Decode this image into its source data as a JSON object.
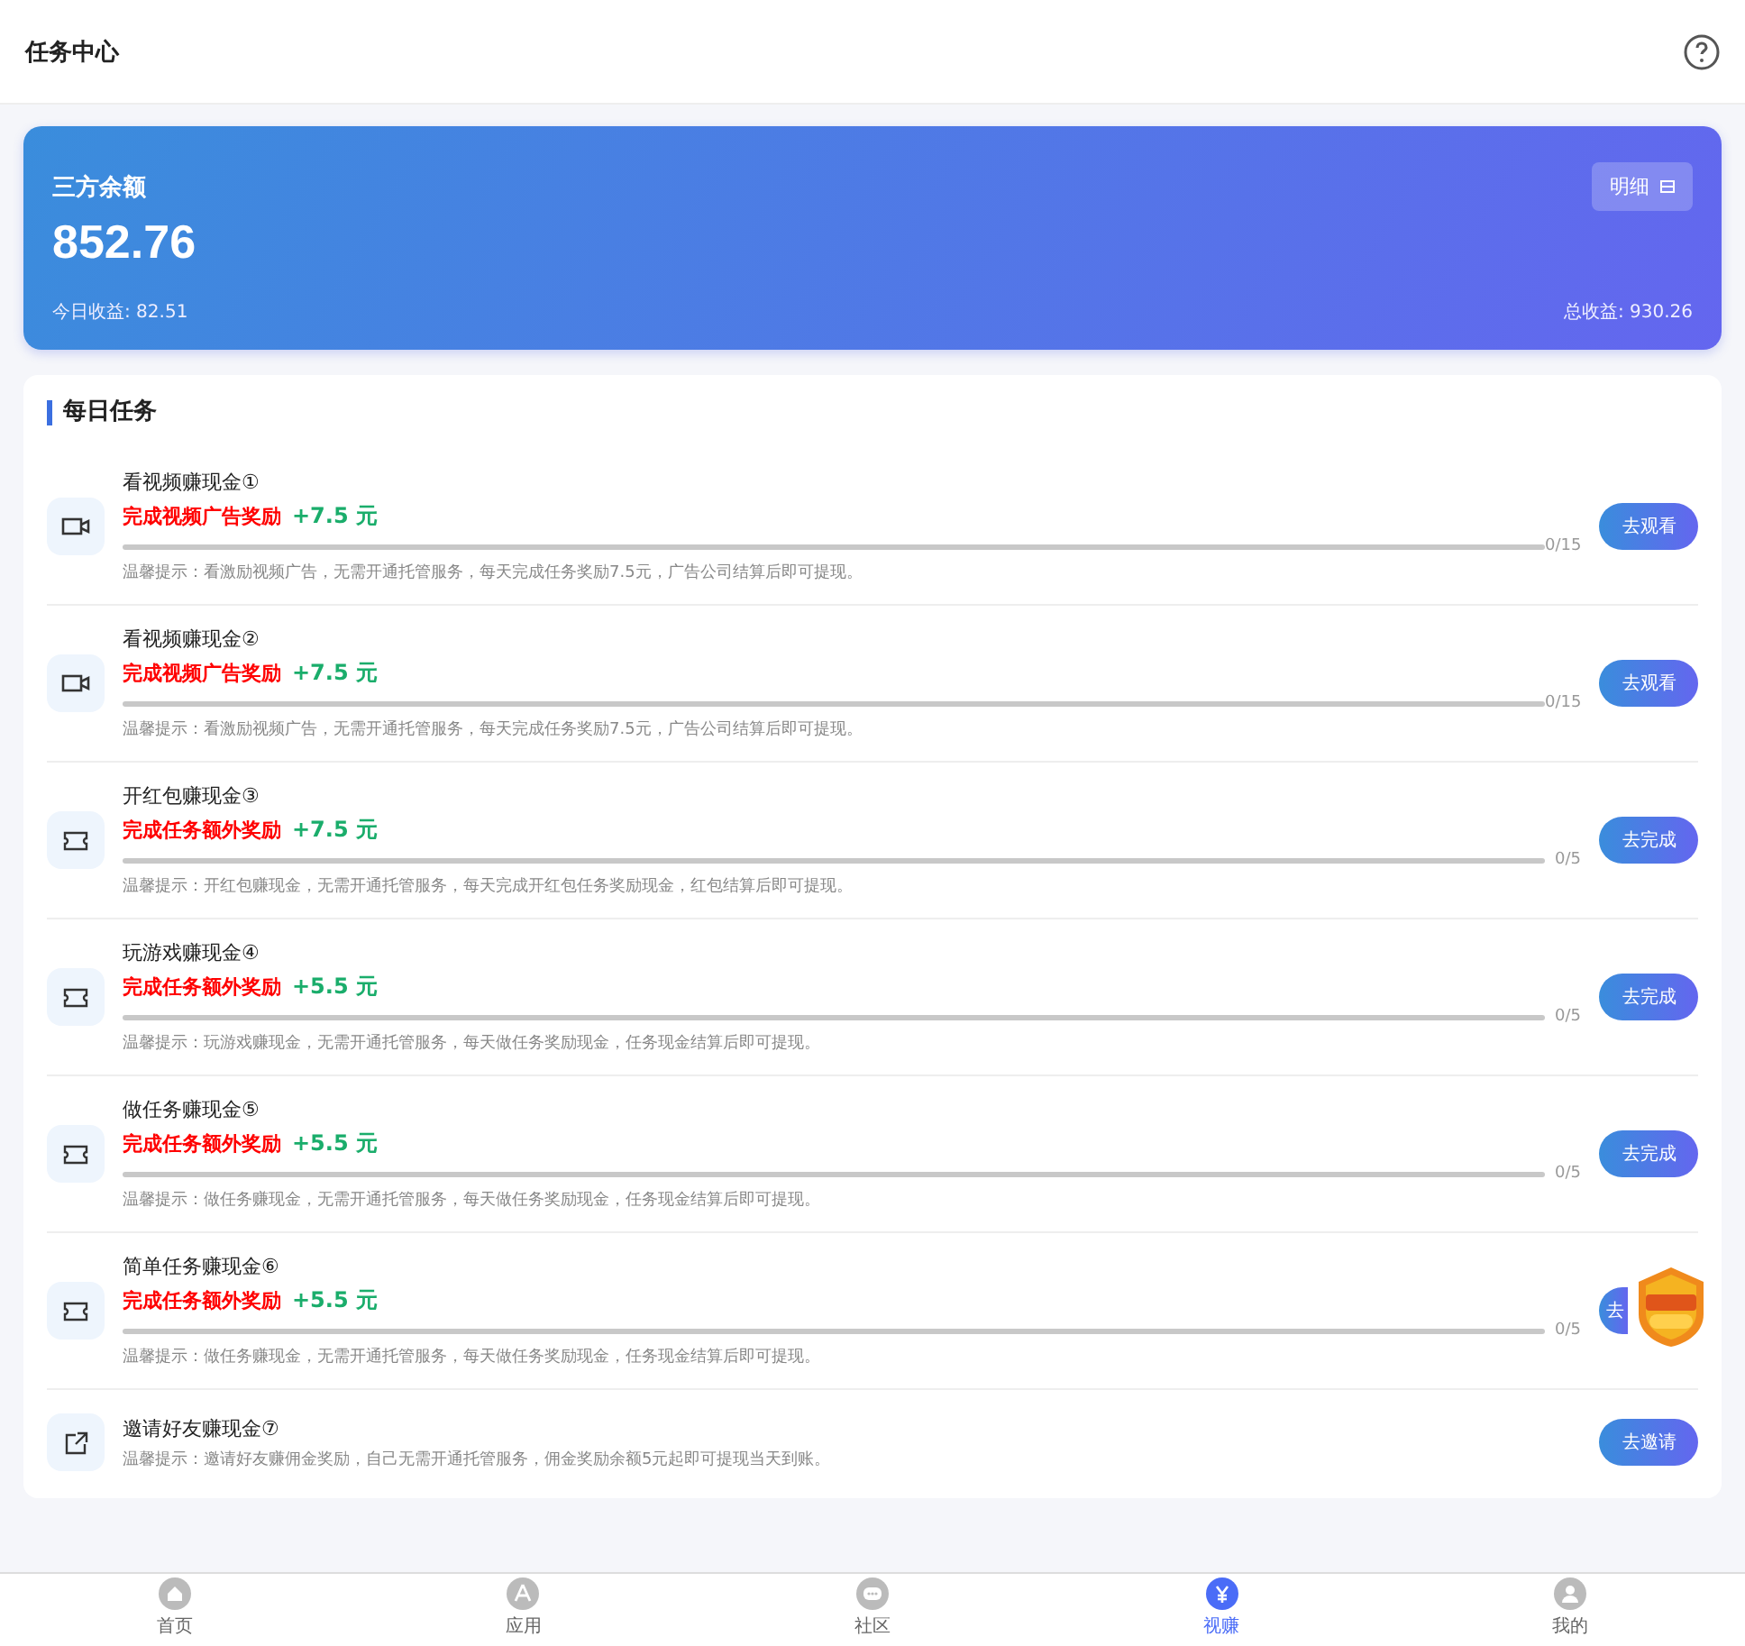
{
  "header": {
    "title": "任务中心"
  },
  "balance": {
    "label": "三方余额",
    "amount": "852.76",
    "detail_button": "明细",
    "today": "今日收益: 82.51",
    "total": "总收益: 930.26"
  },
  "daily": {
    "title": "每日任务",
    "tasks": [
      {
        "kind": "video",
        "name": "看视频赚现金①",
        "reward_label": "完成视频广告奖励",
        "reward": "+7.5 元",
        "level": 0,
        "progress": "0/15",
        "tip": "温馨提示：看激励视频广告，无需开通托管服务，每天完成任务奖励7.5元，广告公司结算后即可提现。",
        "button": "去观看"
      },
      {
        "kind": "video",
        "name": "看视频赚现金②",
        "reward_label": "完成视频广告奖励",
        "reward": "+7.5 元",
        "level": 0,
        "progress": "0/15",
        "tip": "温馨提示：看激励视频广告，无需开通托管服务，每天完成任务奖励7.5元，广告公司结算后即可提现。",
        "button": "去观看"
      },
      {
        "kind": "ticket",
        "name": "开红包赚现金③",
        "reward_label": "完成任务额外奖励",
        "reward": "+7.5 元",
        "level": 0,
        "progress": "0/5",
        "tip": "温馨提示：开红包赚现金，无需开通托管服务，每天完成开红包任务奖励现金，红包结算后即可提现。",
        "button": "去完成"
      },
      {
        "kind": "ticket",
        "name": "玩游戏赚现金④",
        "reward_label": "完成任务额外奖励",
        "reward": "+5.5 元",
        "level": 0,
        "progress": "0/5",
        "tip": "温馨提示：玩游戏赚现金，无需开通托管服务，每天做任务奖励现金，任务现金结算后即可提现。",
        "button": "去完成"
      },
      {
        "kind": "ticket",
        "name": "做任务赚现金⑤",
        "reward_label": "完成任务额外奖励",
        "reward": "+5.5 元",
        "level": 0,
        "progress": "0/5",
        "tip": "温馨提示：做任务赚现金，无需开通托管服务，每天做任务奖励现金，任务现金结算后即可提现。",
        "button": "去完成"
      },
      {
        "kind": "ticket",
        "name": "简单任务赚现金⑥",
        "reward_label": "完成任务额外奖励",
        "reward": "+5.5 元",
        "level": 0,
        "progress": "0/5",
        "tip": "温馨提示：做任务赚现金，无需开通托管服务，每天做任务奖励现金，任务现金结算后即可提现。",
        "button": "去",
        "covered": true
      },
      {
        "kind": "share",
        "name": "邀请好友赚现金⑦",
        "tip": "温馨提示：邀请好友赚佣金奖励，自己无需开通托管服务，佣金奖励余额5元起即可提现当天到账。",
        "button": "去邀请"
      }
    ]
  },
  "tabbar": {
    "items": [
      {
        "kind": "home",
        "label": "首页",
        "selected": false
      },
      {
        "kind": "apps",
        "label": "应用",
        "selected": false
      },
      {
        "kind": "chat",
        "label": "社区",
        "selected": false
      },
      {
        "kind": "money",
        "label": "视赚",
        "selected": true
      },
      {
        "kind": "user",
        "label": "我的",
        "selected": false
      }
    ]
  }
}
